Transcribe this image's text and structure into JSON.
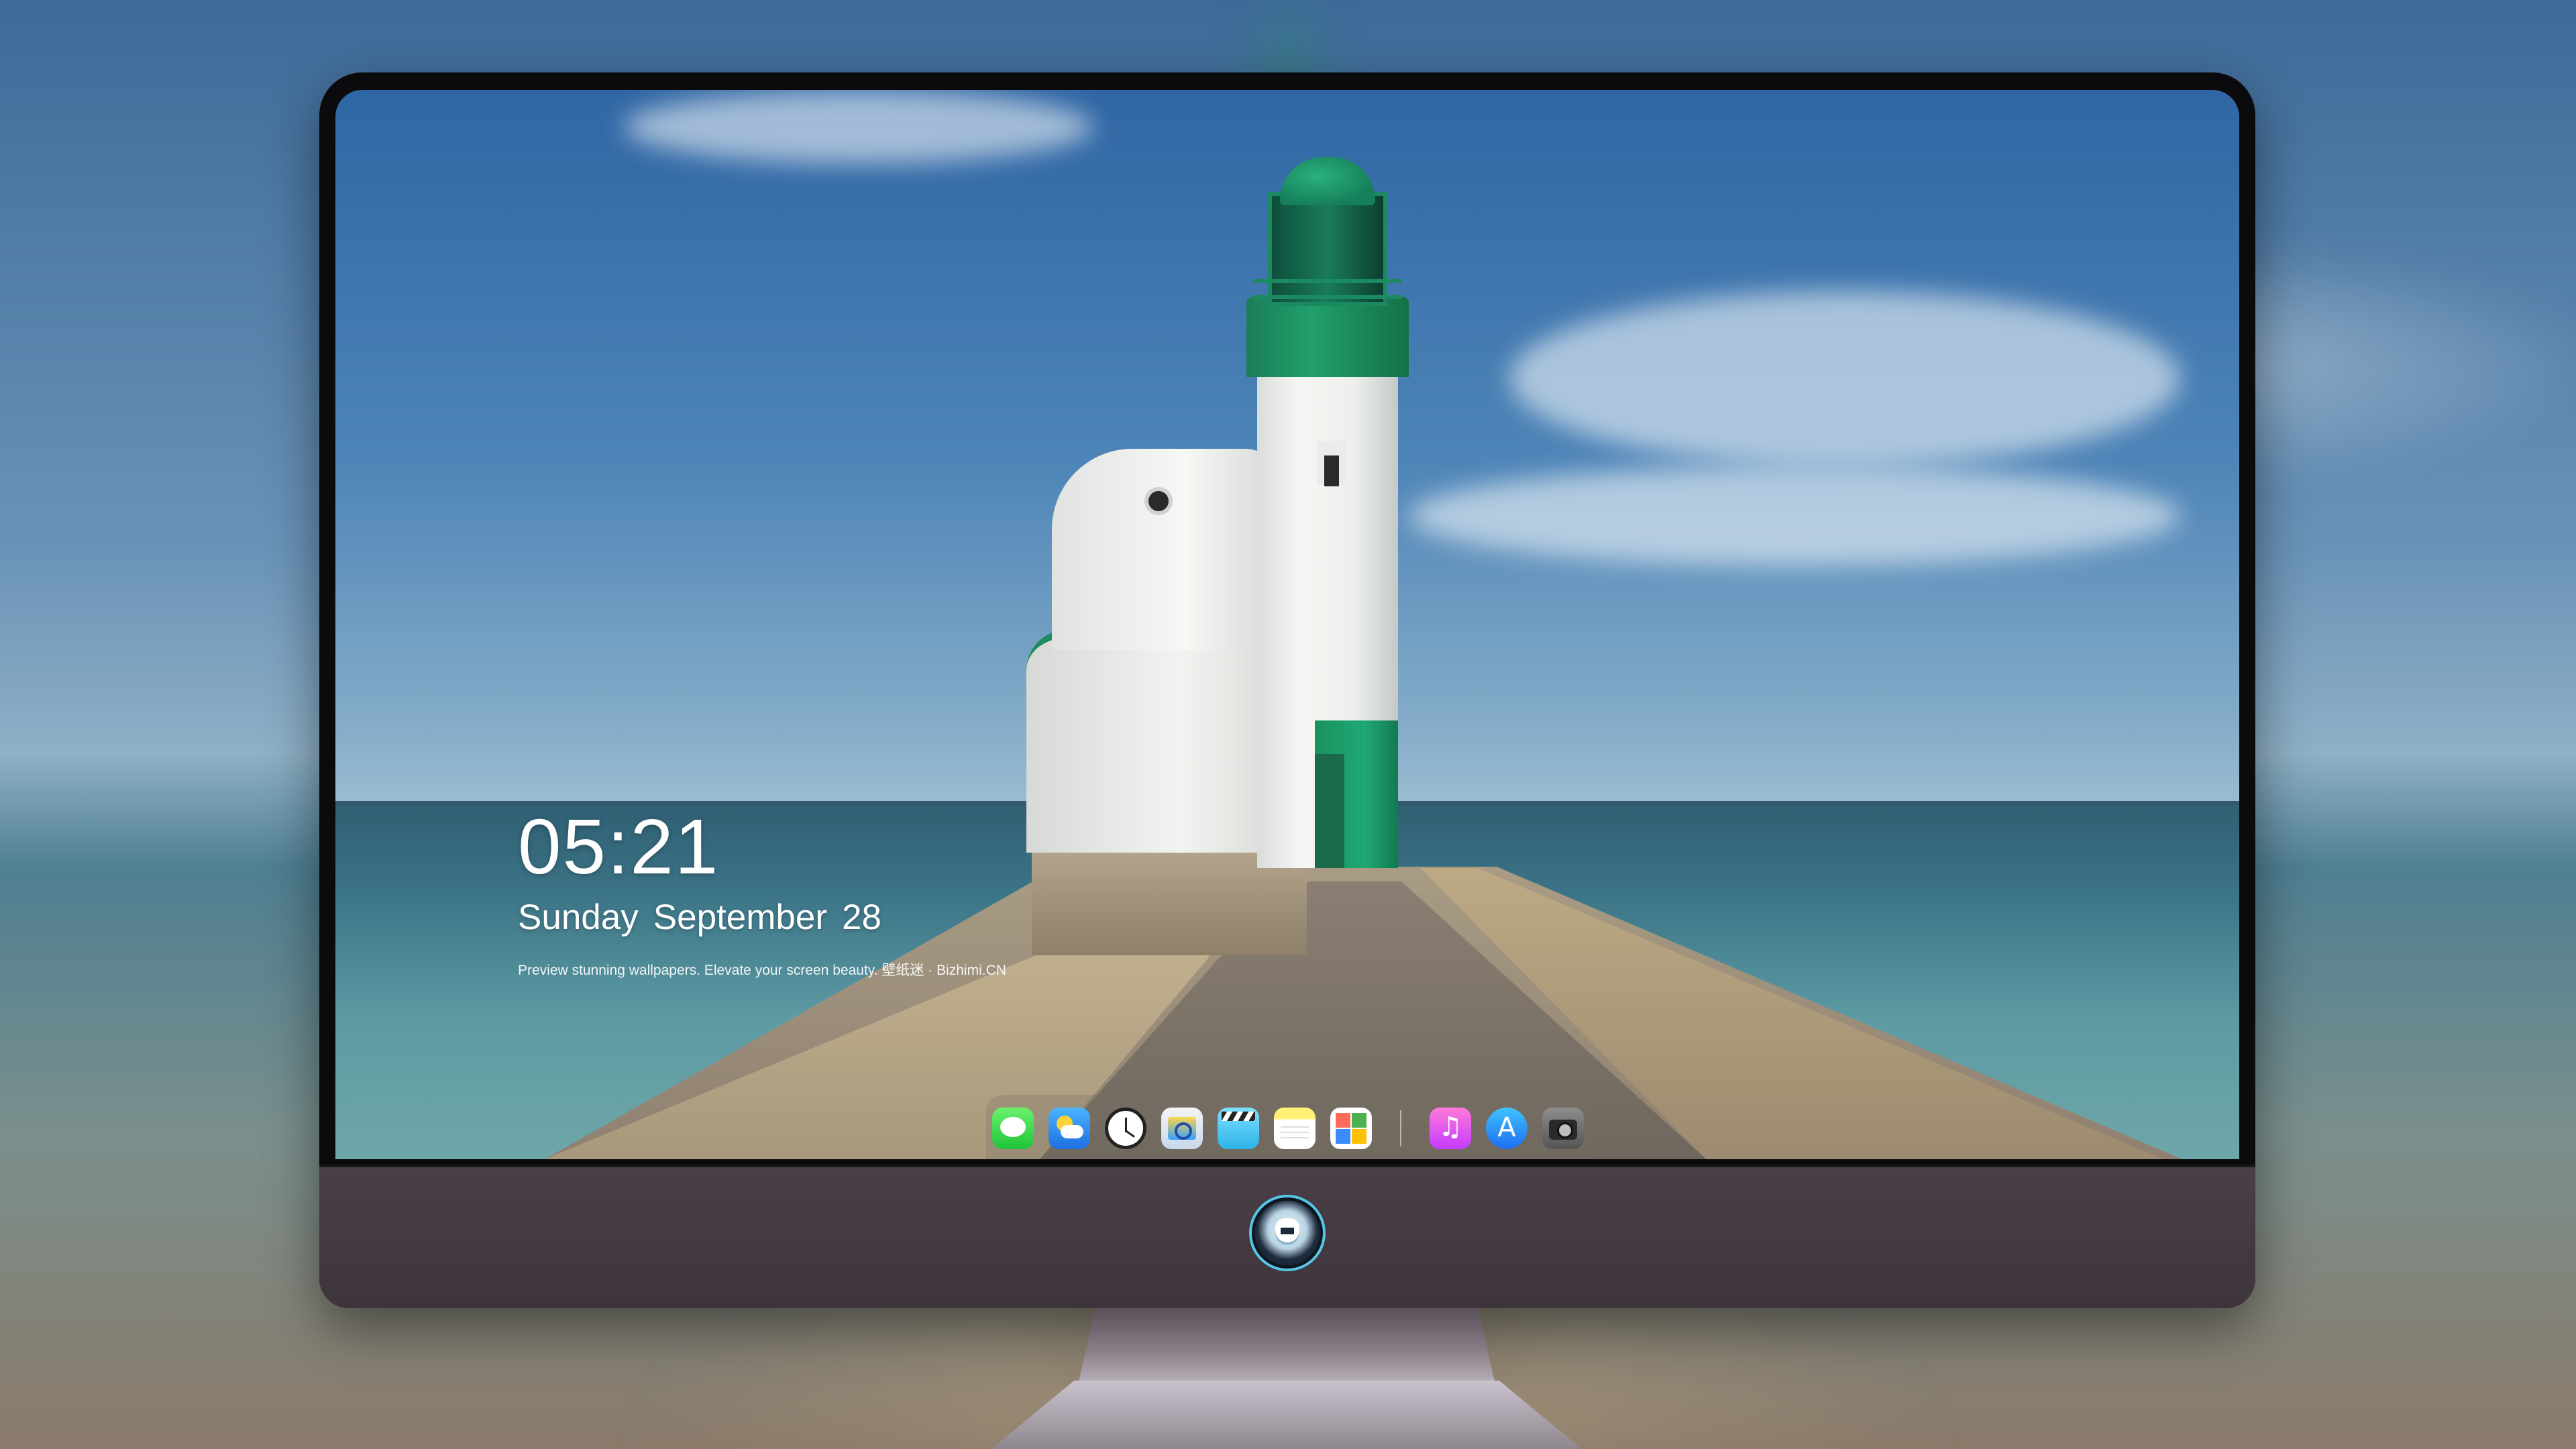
{
  "lock_screen": {
    "time": "05:21",
    "date": {
      "weekday": "Sunday",
      "month": "September",
      "day": "28"
    },
    "tagline": "Preview stunning wallpapers. Elevate your screen beauty. 壁纸迷 · Bizhimi.CN"
  },
  "wallpaper": {
    "subject": "lighthouse-pier"
  },
  "dock": {
    "apps": [
      {
        "name": "messages",
        "icon": "messages-icon"
      },
      {
        "name": "weather",
        "icon": "weather-icon"
      },
      {
        "name": "clock",
        "icon": "clock-icon"
      },
      {
        "name": "preview",
        "icon": "preview-icon"
      },
      {
        "name": "clips",
        "icon": "clips-icon"
      },
      {
        "name": "notes",
        "icon": "notes-icon"
      },
      {
        "name": "photos",
        "icon": "photos-icon"
      },
      {
        "name": "music",
        "icon": "music-icon"
      },
      {
        "name": "app-store",
        "icon": "app-store-icon"
      },
      {
        "name": "camera",
        "icon": "camera-icon"
      }
    ]
  },
  "monitor": {
    "chin_logo": "mascot-logo-icon"
  },
  "colors": {
    "accent_green": "#1fa06c",
    "bezel": "#0b0b0d",
    "chin": "#463c43"
  }
}
